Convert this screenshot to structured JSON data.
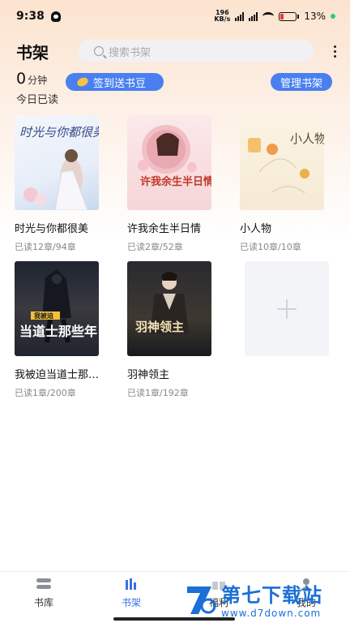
{
  "status_bar": {
    "time": "9:38",
    "net_speed_value": "196",
    "net_speed_unit": "KB/s",
    "battery_percent": "13%"
  },
  "header": {
    "title": "书架",
    "search_placeholder": "搜索书架"
  },
  "stats": {
    "read_minutes": "0",
    "minutes_unit": "分钟",
    "today_label": "今日已读",
    "checkin_label": "签到送书豆",
    "manage_label": "管理书架"
  },
  "books": [
    {
      "title": "时光与你都很美",
      "progress": "已读12章/94章",
      "cover_text": "时光与你都很美"
    },
    {
      "title": "许我余生半日情",
      "progress": "已读2章/52章",
      "cover_text": "许我余生半日情"
    },
    {
      "title": "小人物",
      "progress": "已读10章/10章",
      "cover_text": "小人物"
    },
    {
      "title": "我被迫当道士那…",
      "progress": "已读1章/200章",
      "cover_text_top": "我被迫",
      "cover_text_main": "当道士那些年"
    },
    {
      "title": "羽神领主",
      "progress": "已读1章/192章",
      "cover_text": "羽神领主"
    }
  ],
  "bottom_nav": [
    {
      "label": "书库",
      "icon": "library-icon",
      "active": false
    },
    {
      "label": "书架",
      "icon": "bookshelf-icon",
      "active": true
    },
    {
      "label": "福利",
      "icon": "gift-icon",
      "active": false
    },
    {
      "label": "我的",
      "icon": "user-icon",
      "active": false
    }
  ],
  "watermark": {
    "main": "第七下载站",
    "sub": "www.d7down.com"
  },
  "colors": {
    "accent": "#4a7ff0",
    "nav_active": "#3a6fe8",
    "watermark": "#1b6fd6"
  }
}
